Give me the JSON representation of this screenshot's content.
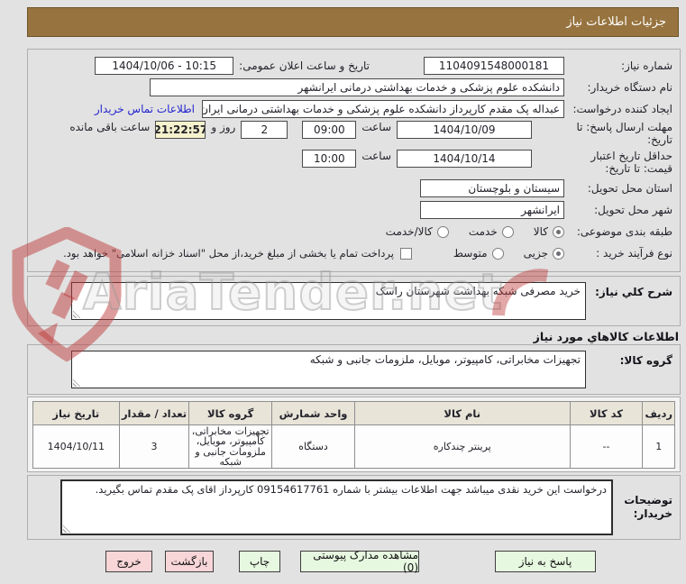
{
  "title_bar": "جزئیات اطلاعات نیاز",
  "watermark": "AriaTender.net",
  "form": {
    "need_number_label": "شماره نیاز:",
    "need_number": "1104091548000181",
    "announce_label": "تاریخ و ساعت اعلان عمومی:",
    "announce_value": "1404/10/06 - 10:15",
    "buyer_label": "نام دستگاه خریدار:",
    "buyer_value": "دانشکده علوم پزشکی و خدمات بهداشتی درمانی ایرانشهر",
    "creator_label": "ایجاد کننده درخواست:",
    "creator_value": "عبداله پک مقدم کارپرداز دانشکده علوم پزشکی و خدمات بهداشتی درمانی ایران",
    "contact_link": "اطلاعات تماس خریدار",
    "deadline_label1": "مهلت ارسال پاسخ: تا",
    "deadline_label2": "تاریخ:",
    "deadline_date": "1404/10/09",
    "hour_label": "ساعت",
    "deadline_time": "09:00",
    "days_remaining": "2",
    "days_label": "روز و",
    "countdown": "21:22:57",
    "countdown_label": "ساعت باقی مانده",
    "validity_label1": "حداقل تاریخ اعتبار",
    "validity_label2": "قیمت: تا تاریخ:",
    "validity_date": "1404/10/14",
    "validity_time": "10:00",
    "province_label": "استان محل تحویل:",
    "province": "سیستان و بلوچستان",
    "city_label": "شهر محل تحویل:",
    "city": "ایرانشهر",
    "class_label": "طبقه بندی موضوعی:",
    "class_options": [
      {
        "label": "کالا",
        "selected": true
      },
      {
        "label": "خدمت",
        "selected": false
      },
      {
        "label": "کالا/خدمت",
        "selected": false
      }
    ],
    "process_label": "نوع فرآیند خرید :",
    "process_options": [
      {
        "label": "جزیی",
        "selected": true
      },
      {
        "label": "متوسط",
        "selected": false
      }
    ],
    "treasury_note": "پرداخت تمام یا بخشی از مبلغ خرید،از محل \"اسناد خزانه اسلامی\" خواهد بود.",
    "treasury_checked": false
  },
  "general_desc": {
    "label": "شرح کلي نیاز:",
    "value": "خرید مصرفی شبکه بهداشت شهرستان راسک"
  },
  "goods_info_title": "اطلاعات کالاهاي مورد نیاز",
  "goods_group": {
    "label": "گروه کالا:",
    "value": "تجهیزات مخابراتی، کامپیوتر، موبایل، ملزومات جانبی و شبکه"
  },
  "goods_table": {
    "headers": [
      "ردیف",
      "کد کالا",
      "نام کالا",
      "واحد شمارش",
      "گروه کالا",
      "تعداد / مقدار",
      "تاریخ نیاز"
    ],
    "rows": [
      [
        "1",
        "--",
        "پرینتر چندکاره",
        "دستگاه",
        "تجهیزات مخابراتی، کامپیوتر، موبایل، ملزومات جانبی و شبکه",
        "3",
        "1404/10/11"
      ]
    ]
  },
  "buyer_notes": {
    "label1": "توضیحات",
    "label2": "خریدار:",
    "value": "درخواست این خرید نقدی میباشد جهت اطلاعات بیشتر با شماره 09154617761 کارپرداز اقای پک مقدم  تماس بگیرید."
  },
  "buttons": {
    "respond": "پاسخ به نیاز",
    "attachments": "مشاهده مدارک پیوستی (0)",
    "print": "چاپ",
    "back": "بازگشت",
    "exit": "خروج"
  },
  "colors": {
    "header_bg": "#97743F",
    "link": "#2525d0",
    "countdown_bg": "#f6f2cd",
    "button_green": "#e7f8e1",
    "button_pink": "#f8d6d8"
  }
}
